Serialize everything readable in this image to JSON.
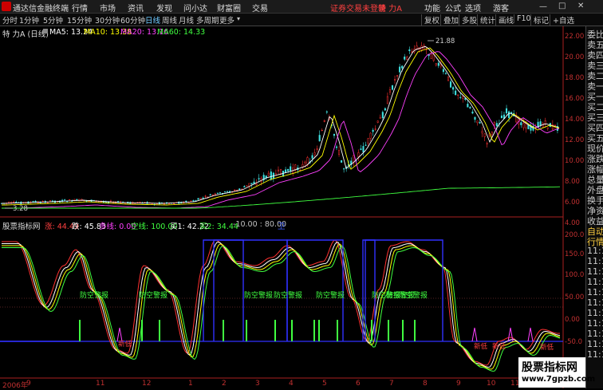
{
  "app": {
    "title": "通达信金融终端"
  },
  "menu": [
    "行情",
    "市场",
    "资讯",
    "发现",
    "问小达",
    "财富圈",
    "交易"
  ],
  "notice": "证券交易未登录",
  "stock_tag": "特 力A",
  "right_menu": [
    "功能",
    "公式",
    "选项",
    "游客"
  ],
  "periods": [
    "分时",
    "1分钟",
    "5分钟",
    "15分钟",
    "30分钟",
    "60分钟",
    "日线",
    "周线",
    "月线",
    "多周期",
    "更多"
  ],
  "active_period": "日线",
  "right_tools": [
    "复权",
    "叠加",
    "多股",
    "统计",
    "画线",
    "F10",
    "标记",
    "+自选"
  ],
  "kline": {
    "title": "特 力A (日线)",
    "ma5": "MA5: 13.24",
    "ma10": "MA10: 13.38",
    "ma20": "MA20: 13.16",
    "ma60": "MA60: 14.33",
    "high_label": "21.88",
    "low_label": "3.28",
    "colors": {
      "ma5": "#ffffff",
      "ma10": "#ffff00",
      "ma20": "#ff40ff",
      "ma60": "#40ff40"
    }
  },
  "indicator": {
    "name": "股票指标网",
    "zhang": "涨: 44.49",
    "die": "跌: 45.83",
    "duo": "多线: 0.00",
    "kong": "空线: 100.00",
    "buy1": "买1: 42.22",
    "buy2": "买2: 34.44",
    "levels": "-10.00 : 80.00",
    "wei": "卫",
    "labels": [
      "防空警报",
      "防空警报",
      "防空警报",
      "防空警报",
      "防空警报",
      "防空警报",
      "防空警报",
      "防空警报"
    ],
    "bottom_labels": [
      "新低",
      "新低",
      "新低",
      "新低"
    ]
  },
  "price_axis": [
    "22.00",
    "20.00",
    "18.00",
    "16.00",
    "14.00",
    "12.00",
    "10.00",
    "8.00",
    "6.00",
    "4.00"
  ],
  "ind_axis": [
    "200.0",
    "150.0",
    "100.0",
    "50.00",
    "0.00",
    "-50.0"
  ],
  "x_axis": [
    "2006年",
    "9",
    "11",
    "12",
    "1",
    "2",
    "3",
    "4",
    "5",
    "6",
    "7",
    "8",
    "9",
    "10",
    "11"
  ],
  "side_labels": [
    "委比",
    "卖五",
    "卖四",
    "卖三",
    "卖二",
    "卖一",
    "买一",
    "买二",
    "买三",
    "买四",
    "买五",
    "现价",
    "涨跌",
    "涨幅",
    "总量",
    "外盘",
    "换手",
    "净资",
    "收益",
    "自动",
    "行情",
    "11:1",
    "11:1",
    "11:1",
    "11:1",
    "11:1",
    "11:1",
    "11:1",
    "11:1",
    "11:1",
    "11:1",
    "11:1"
  ],
  "watermark": {
    "line1": "股票指标网",
    "line2": "www.7gpzb.com"
  }
}
